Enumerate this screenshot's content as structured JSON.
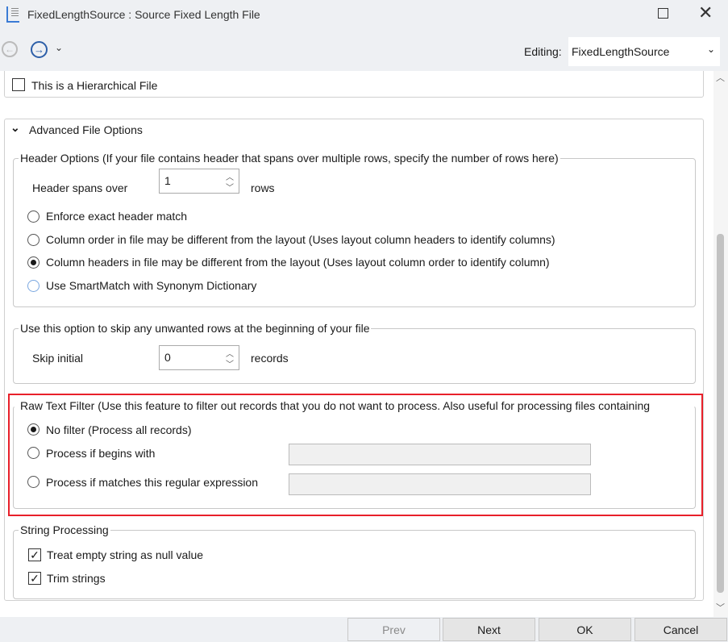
{
  "window": {
    "title": "FixedLengthSource : Source Fixed Length File"
  },
  "toolbar": {
    "editing_label": "Editing:",
    "editing_value": "FixedLengthSource"
  },
  "hierarchical": {
    "label": "This is a Hierarchical File",
    "checked": false
  },
  "advanced": {
    "title": "Advanced File Options",
    "header": {
      "legend": "Header Options (If your file contains header that spans over multiple rows, specify the number of rows here)",
      "spans_label": "Header spans over",
      "spans_value": "1",
      "spans_unit": "rows",
      "options": [
        {
          "label": "Enforce exact header match",
          "selected": false
        },
        {
          "label": "Column order in file may be different from the layout (Uses layout column headers to identify columns)",
          "selected": false
        },
        {
          "label": "Column headers in file may be different from the layout (Uses layout column order to identify column)",
          "selected": true
        },
        {
          "label": "Use SmartMatch with Synonym Dictionary",
          "selected": false
        }
      ]
    },
    "skip": {
      "legend": "Use this option to skip any unwanted rows at the beginning of your file",
      "label": "Skip initial",
      "value": "0",
      "unit": "records"
    },
    "filter": {
      "legend": "Raw Text Filter (Use this feature to filter out records that you do not want to process. Also useful for processing files containing",
      "options": [
        {
          "label": "No filter (Process all records)",
          "selected": true
        },
        {
          "label": "Process if begins with",
          "selected": false,
          "value": ""
        },
        {
          "label": "Process if matches this regular expression",
          "selected": false,
          "value": ""
        }
      ],
      "highlight_color": "#e8202a"
    },
    "string": {
      "legend": "String Processing",
      "options": [
        {
          "label": "Treat empty string as null value",
          "checked": true
        },
        {
          "label": "Trim strings",
          "checked": true
        }
      ]
    }
  },
  "footer": {
    "prev": "Prev",
    "next": "Next",
    "ok": "OK",
    "cancel": "Cancel"
  }
}
